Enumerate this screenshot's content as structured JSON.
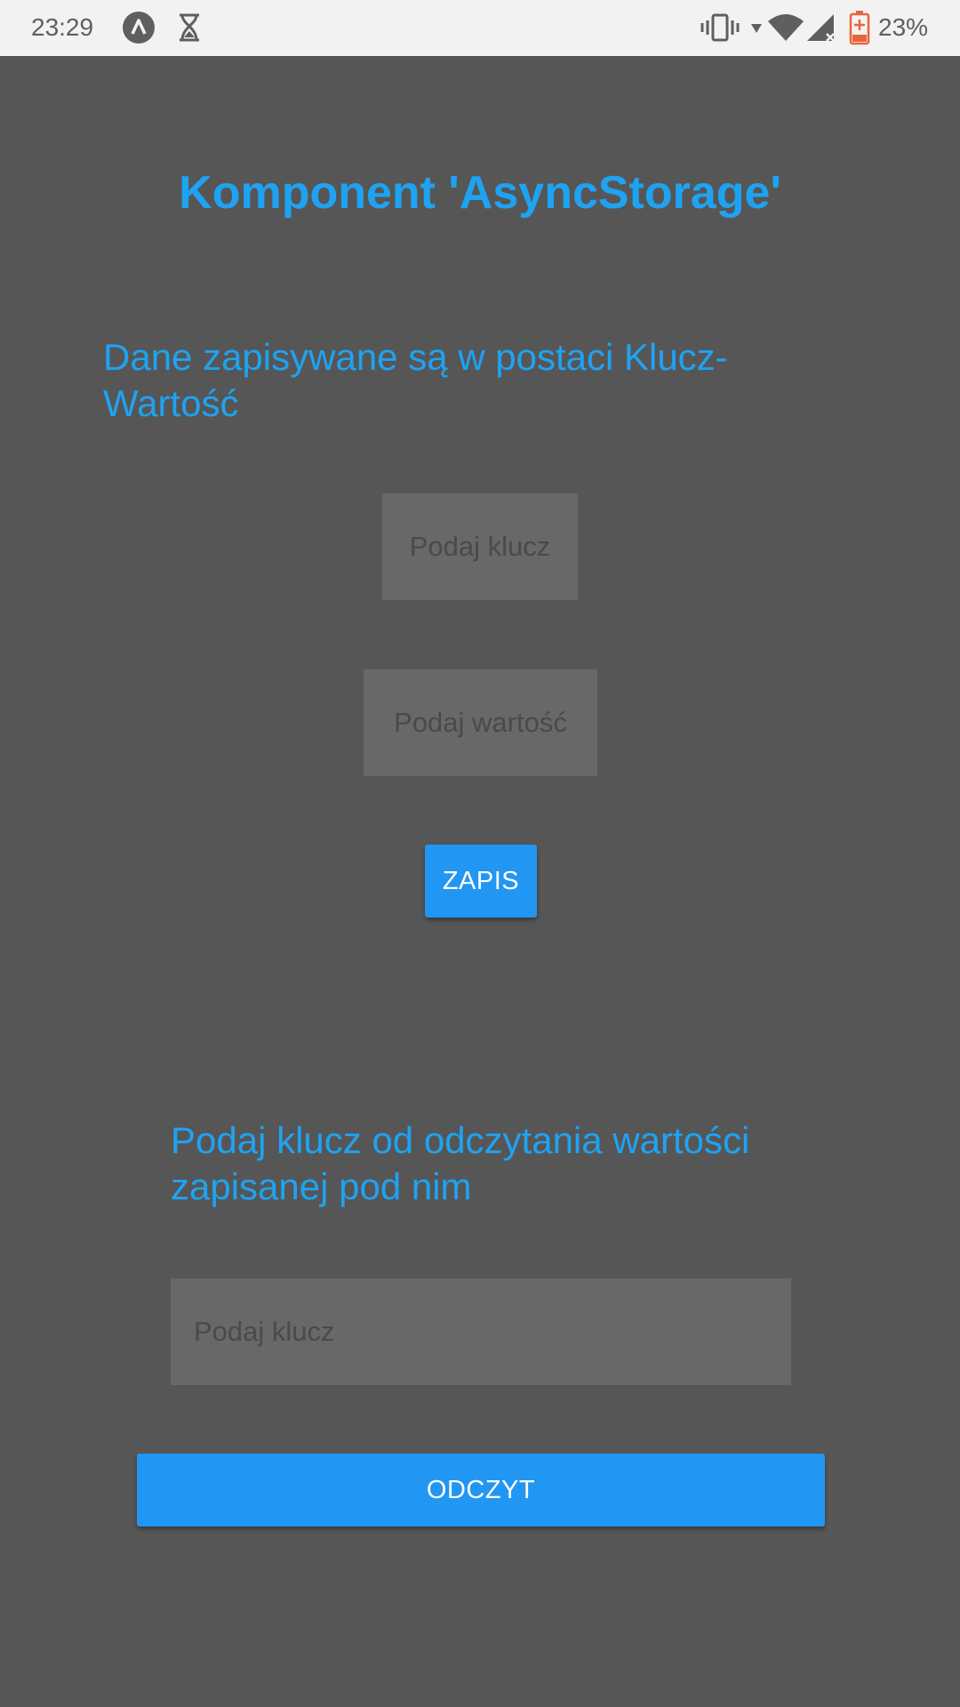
{
  "status_bar": {
    "time": "23:29",
    "battery_percent": "23%",
    "icons": [
      "app-icon",
      "hourglass-icon",
      "vibrate-icon",
      "dropdown-icon",
      "wifi-icon",
      "signal-icon",
      "battery-icon"
    ]
  },
  "page": {
    "title": "Komponent 'AsyncStorage'"
  },
  "save_section": {
    "heading": "Dane zapisywane są w postaci Klucz-Wartość",
    "key_input": {
      "placeholder": "Podaj klucz",
      "value": ""
    },
    "value_input": {
      "placeholder": "Podaj wartość",
      "value": ""
    },
    "save_button_label": "ZAPIS"
  },
  "read_section": {
    "heading": "Podaj klucz od odczytania wartości zapisanej pod nim",
    "key_input": {
      "placeholder": "Podaj klucz",
      "value": ""
    },
    "read_button_label": "ODCZYT"
  },
  "colors": {
    "background": "#565656",
    "accent_text": "#1ea3f2",
    "button": "#2196f3",
    "input_background": "#686868",
    "status_bar": "#f2f2f2"
  }
}
